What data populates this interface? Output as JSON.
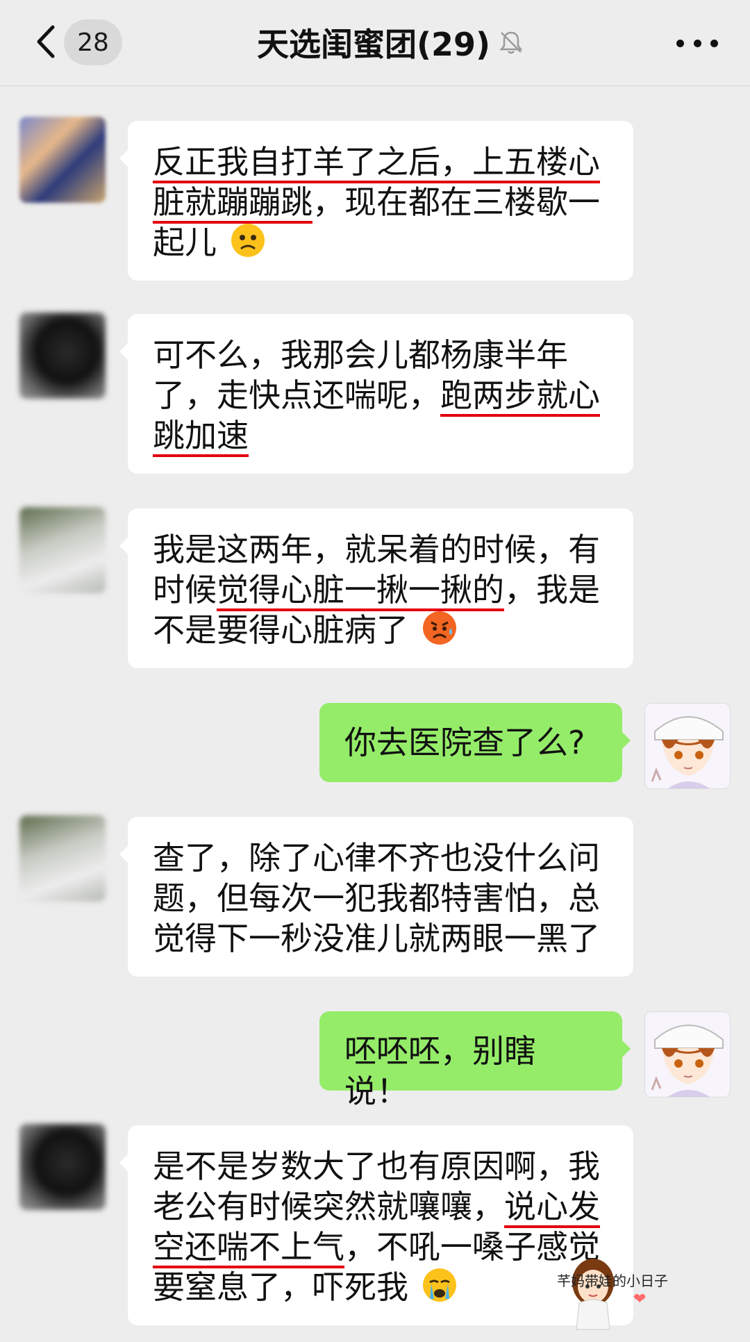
{
  "header": {
    "back_icon": "chevron-left-icon",
    "unread_count": "28",
    "title": "天选闺蜜团(29)",
    "mute_icon": "bell-off-icon",
    "more_icon": "more-dots-icon"
  },
  "messages": [
    {
      "side": "in",
      "avatar": "blurred-colorful",
      "segments": [
        {
          "text": "反正我自打羊了之后，上五楼心脏就蹦蹦跳",
          "underline": true
        },
        {
          "text": "，现在都在三楼歇一起儿",
          "underline": false
        }
      ],
      "emoji": "frowning-face-emoji"
    },
    {
      "side": "in",
      "avatar": "blurred-dark",
      "segments": [
        {
          "text": "可不么，我那会儿都杨康半年了，走快点还喘呢，",
          "underline": false
        },
        {
          "text": "跑两步就心跳加速",
          "underline": true
        }
      ]
    },
    {
      "side": "in",
      "avatar": "blurred-plant",
      "segments": [
        {
          "text": "我是这两年，就呆着的时候，有时候",
          "underline": false
        },
        {
          "text": "觉得心脏一揪一揪的",
          "underline": true
        },
        {
          "text": "，我是不是要得心脏病了",
          "underline": false
        }
      ],
      "emoji": "anxious-sweat-emoji"
    },
    {
      "side": "out",
      "avatar": "anime-girl",
      "segments": [
        {
          "text": "你去医院查了么?",
          "underline": false
        }
      ]
    },
    {
      "side": "in",
      "avatar": "blurred-plant",
      "segments": [
        {
          "text": "查了，除了心律不齐也没什么问题，但每次一犯我都特害怕，总觉得下一秒没准儿就两眼一黑了",
          "underline": false
        }
      ]
    },
    {
      "side": "out",
      "avatar": "anime-girl",
      "segments": [
        {
          "text": "呸呸呸，别瞎说！",
          "underline": false
        }
      ]
    },
    {
      "side": "in",
      "avatar": "blurred-dark",
      "segments": [
        {
          "text": "是不是岁数大了也有原因啊，我老公有时候突然就嚷嚷，",
          "underline": false
        },
        {
          "text": "说心发空还喘不上气",
          "underline": true
        },
        {
          "text": "，不吼一嗓子感觉要窒息了，吓死我",
          "underline": false
        }
      ],
      "emoji": "crying-face-emoji"
    }
  ],
  "watermark": {
    "text": "芊妈带娃的小日子",
    "heart_icon": "heart-icon"
  },
  "colors": {
    "background": "#ededed",
    "incoming_bubble": "#ffffff",
    "outgoing_bubble": "#95ec69",
    "underline": "#e3000f"
  }
}
